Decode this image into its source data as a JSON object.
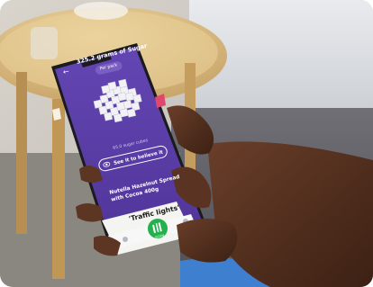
{
  "screen": {
    "title": "325.2 grams of Sugar",
    "chip_label": "Per pack",
    "sugar_cubes_label": "65.0 sugar cubes",
    "see_button_label": "See it to believe it",
    "product_name": "Nutella Hazelnut Spread\nwith Cocoa 400g",
    "traffic_label": "'Traffic lights'",
    "scan_label": "SCAN"
  },
  "icons": {
    "back": "arrow-left-icon",
    "eye": "eye-icon",
    "scan": "barcode-icon"
  },
  "colors": {
    "app_purple": "#5b3fa6",
    "scan_green": "#22b14c"
  }
}
